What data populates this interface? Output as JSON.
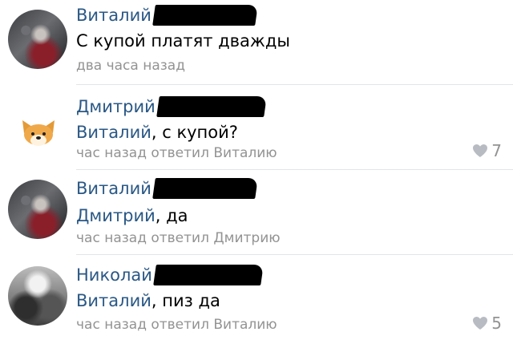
{
  "comments": [
    {
      "author": "Виталий",
      "text": "С купой платят дважды",
      "reply_to": "",
      "meta": "два часа назад",
      "likes": ""
    },
    {
      "author": "Дмитрий",
      "reply_to": "Виталий",
      "text": ", с купой?",
      "meta": "час назад ответил Виталию",
      "likes": "7"
    },
    {
      "author": "Виталий",
      "reply_to": "Дмитрий",
      "text": ", да",
      "meta": "час назад ответил Дмитрию",
      "likes": ""
    },
    {
      "author": "Николай",
      "reply_to": "Виталий",
      "text": ", пиз да",
      "meta": "час назад ответил Виталию",
      "likes": "5"
    }
  ],
  "colors": {
    "link": "#2a5885",
    "meta": "#939393",
    "heart": "#b8bcc2"
  }
}
